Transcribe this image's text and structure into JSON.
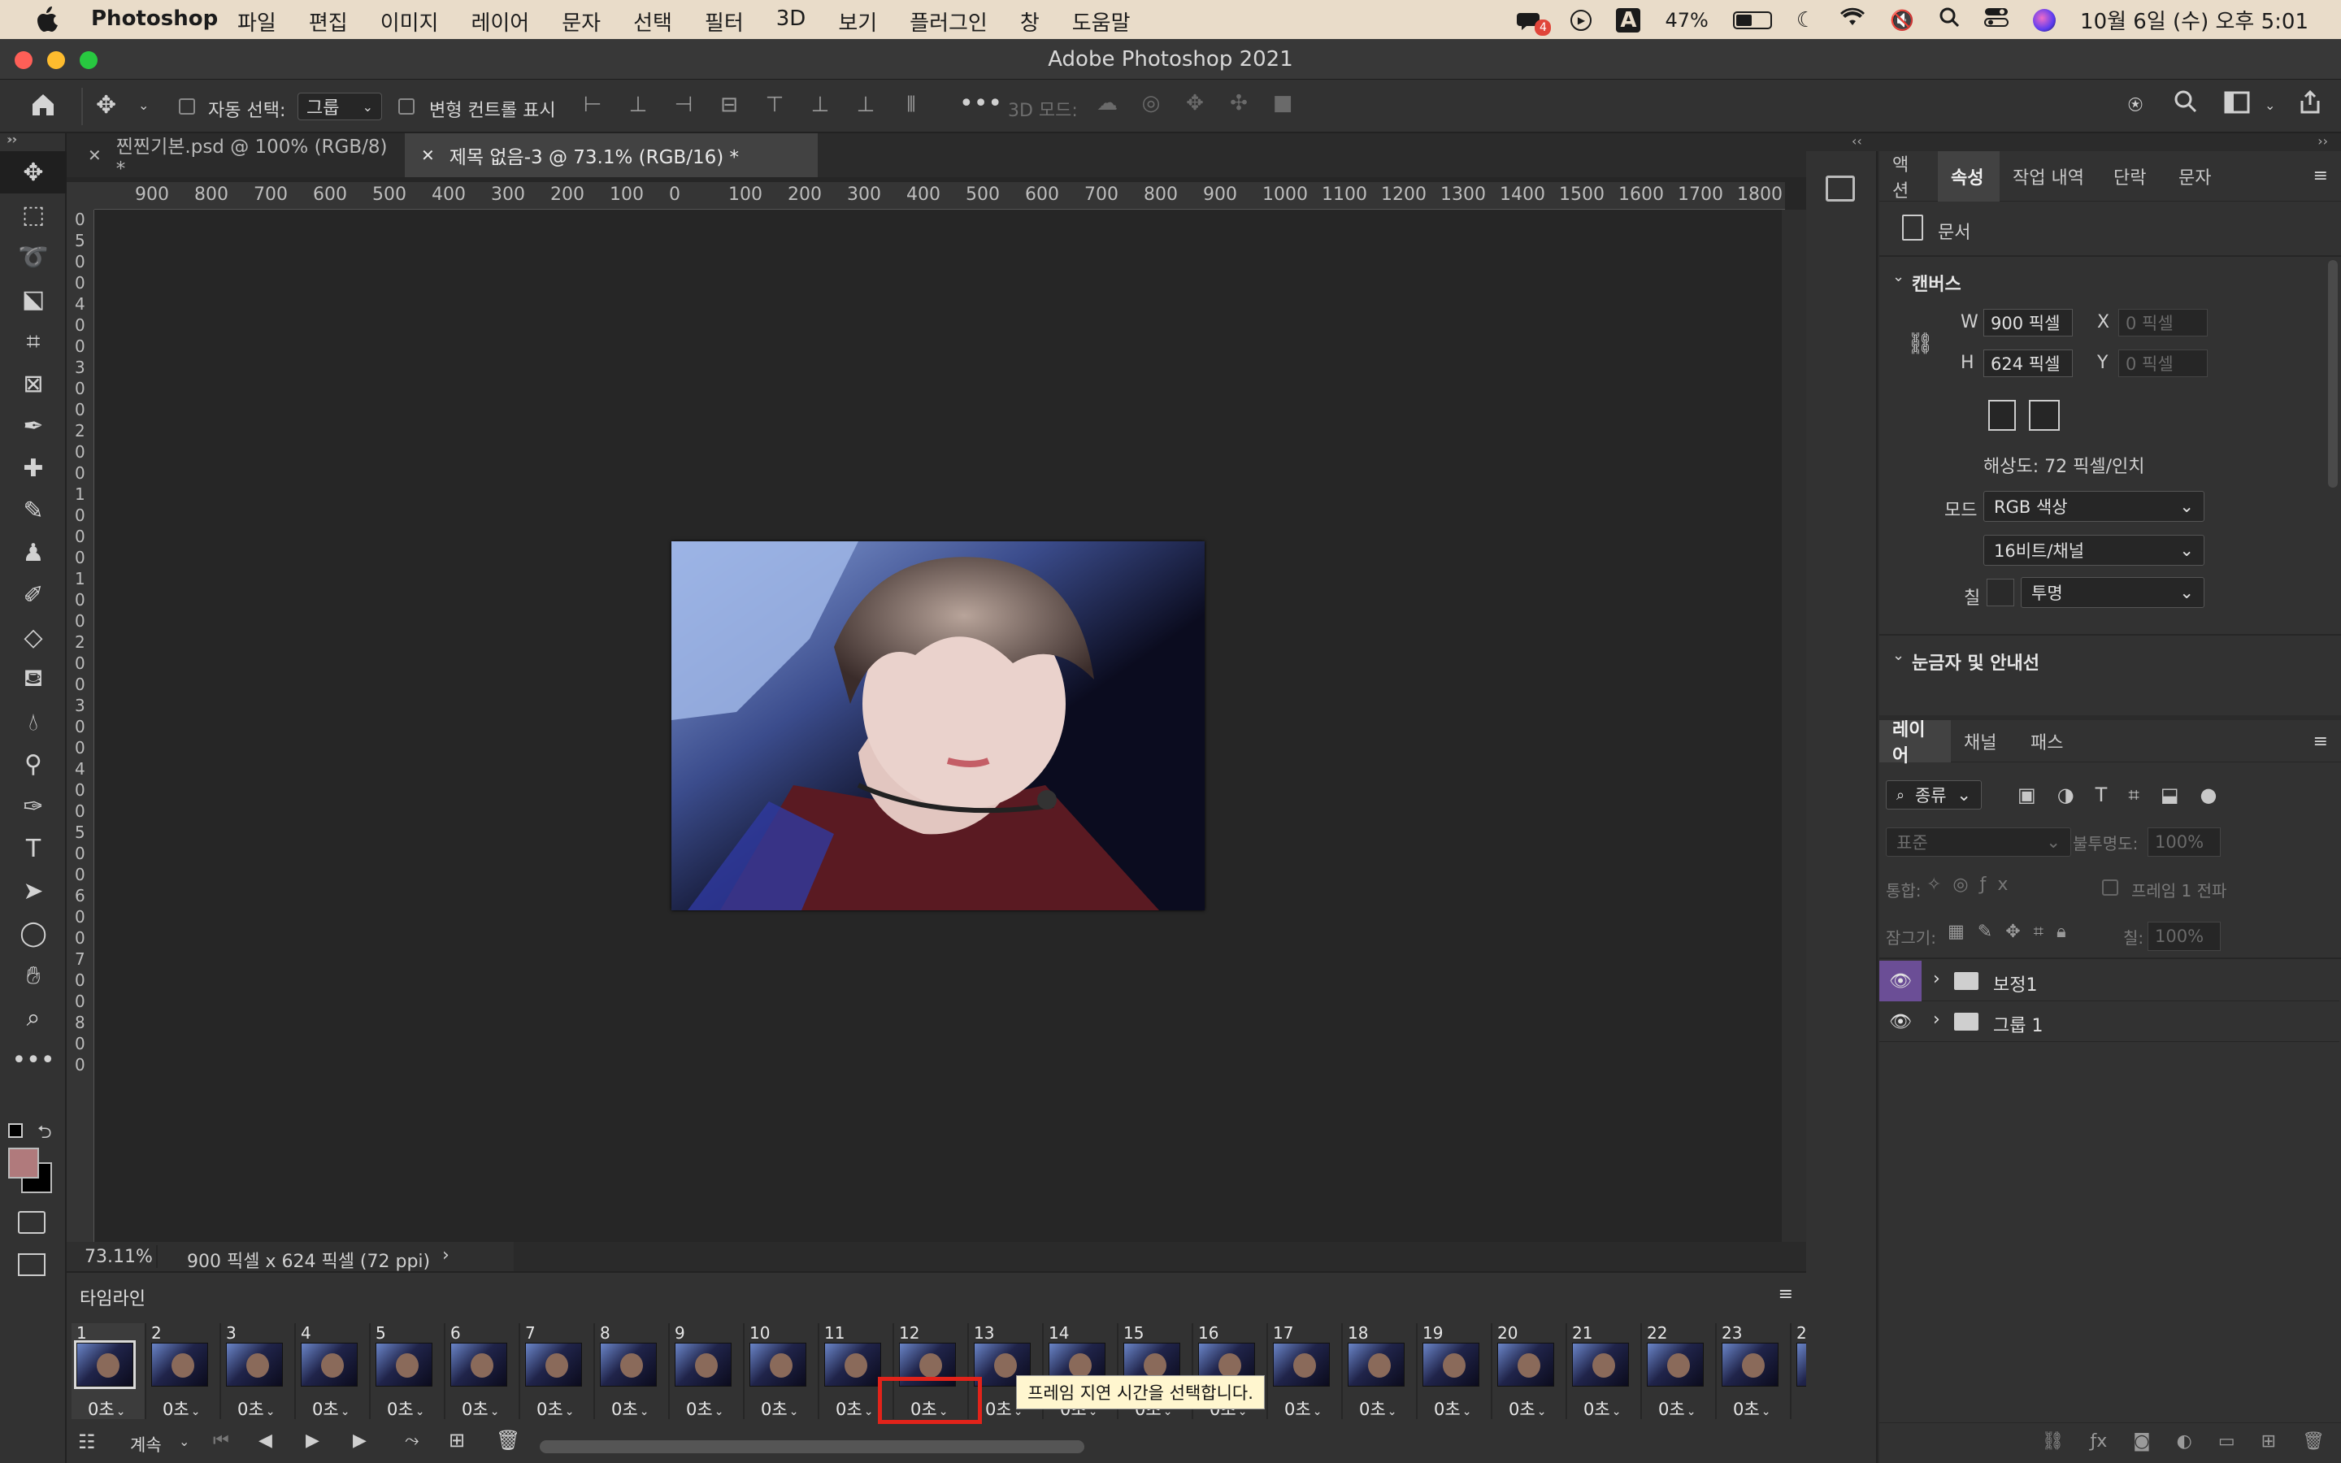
{
  "menubar": {
    "app_name": "Photoshop",
    "menus": [
      "파일",
      "편집",
      "이미지",
      "레이어",
      "문자",
      "선택",
      "필터",
      "3D",
      "보기",
      "플러그인",
      "창",
      "도움말"
    ],
    "battery_percent": "47%",
    "input_indicator": "A",
    "notification_badge": "4",
    "clock": "10월 6일 (수) 오후 5:01",
    "battery_level": 0.47
  },
  "window": {
    "title": "Adobe Photoshop 2021"
  },
  "options_bar": {
    "auto_select_label": "자동 선택:",
    "auto_select_value": "그룹",
    "transform_controls_label": "변형 컨트롤 표시",
    "mode_3d_label": "3D 모드:"
  },
  "tabs": [
    {
      "label": "찐찐기본.psd @ 100% (RGB/8) *",
      "active": false
    },
    {
      "label": "제목 없음-3 @ 73.1% (RGB/16) *",
      "active": true
    }
  ],
  "ruler": {
    "h_labels": [
      "900",
      "800",
      "700",
      "600",
      "500",
      "400",
      "300",
      "200",
      "100",
      "0",
      "100",
      "200",
      "300",
      "400",
      "500",
      "600",
      "700",
      "800",
      "900",
      "1000",
      "1100",
      "1200",
      "1300",
      "1400",
      "1500",
      "1600",
      "1700",
      "1800"
    ],
    "v_labels": [
      "0",
      "5",
      "0",
      "0",
      "4",
      "0",
      "0",
      "3",
      "0",
      "0",
      "2",
      "0",
      "0",
      "1",
      "0",
      "0",
      "0",
      "1",
      "0",
      "0",
      "2",
      "0",
      "0",
      "3",
      "0",
      "0",
      "4",
      "0",
      "0",
      "5",
      "0",
      "0",
      "6",
      "0",
      "0",
      "7",
      "0",
      "0",
      "8",
      "0",
      "0"
    ]
  },
  "status_bar": {
    "zoom": "73.11%",
    "doc_info": "900 픽셀 x 624 픽셀 (72 ppi)"
  },
  "timeline": {
    "title": "타임라인",
    "loop_label": "계속",
    "frames": [
      {
        "num": "1",
        "delay": "0초"
      },
      {
        "num": "2",
        "delay": "0초"
      },
      {
        "num": "3",
        "delay": "0초"
      },
      {
        "num": "4",
        "delay": "0초"
      },
      {
        "num": "5",
        "delay": "0초"
      },
      {
        "num": "6",
        "delay": "0초"
      },
      {
        "num": "7",
        "delay": "0초"
      },
      {
        "num": "8",
        "delay": "0초"
      },
      {
        "num": "9",
        "delay": "0초"
      },
      {
        "num": "10",
        "delay": "0초"
      },
      {
        "num": "11",
        "delay": "0초"
      },
      {
        "num": "12",
        "delay": "0초"
      },
      {
        "num": "13",
        "delay": "0초"
      },
      {
        "num": "14",
        "delay": "0초"
      },
      {
        "num": "15",
        "delay": "0초"
      },
      {
        "num": "16",
        "delay": "0초"
      },
      {
        "num": "17",
        "delay": "0초"
      },
      {
        "num": "18",
        "delay": "0초"
      },
      {
        "num": "19",
        "delay": "0초"
      },
      {
        "num": "20",
        "delay": "0초"
      },
      {
        "num": "21",
        "delay": "0초"
      },
      {
        "num": "22",
        "delay": "0초"
      },
      {
        "num": "23",
        "delay": "0초"
      },
      {
        "num": "2",
        "delay": ""
      }
    ],
    "tooltip": "프레임 지연 시간을 선택합니다."
  },
  "properties": {
    "tabs": [
      "액션",
      "속성",
      "작업 내역",
      "단락",
      "문자"
    ],
    "active_tab": "속성",
    "doc_label": "문서",
    "canvas_section": "캔버스",
    "w_label": "W",
    "w_value": "900 픽셀",
    "h_label": "H",
    "h_value": "624 픽셀",
    "x_label": "X",
    "x_placeholder": "0 픽셀",
    "y_label": "Y",
    "y_placeholder": "0 픽셀",
    "resolution": "해상도: 72 픽셀/인치",
    "mode_label": "모드",
    "mode_value": "RGB 색상",
    "depth_value": "16비트/채널",
    "fill_label": "칠",
    "fill_value": "투명",
    "rulers_section": "눈금자 및 안내선"
  },
  "layers": {
    "tabs": [
      "레이어",
      "채널",
      "패스"
    ],
    "filter_kind": "종류",
    "blend_mode": "표준",
    "opacity_label": "불투명도:",
    "opacity_value": "100%",
    "unify_label": "통합:",
    "propagate_label": "프레임 1 전파",
    "lock_label": "잠그기:",
    "fill_label": "칠:",
    "fill_value": "100%",
    "items": [
      {
        "name": "보정1"
      },
      {
        "name": "그룹 1"
      }
    ]
  },
  "colors": {
    "foreground": "#b07a7c",
    "background": "#000000",
    "highlight": "#e2231a",
    "layer_eye_active": "#6b4e96"
  }
}
